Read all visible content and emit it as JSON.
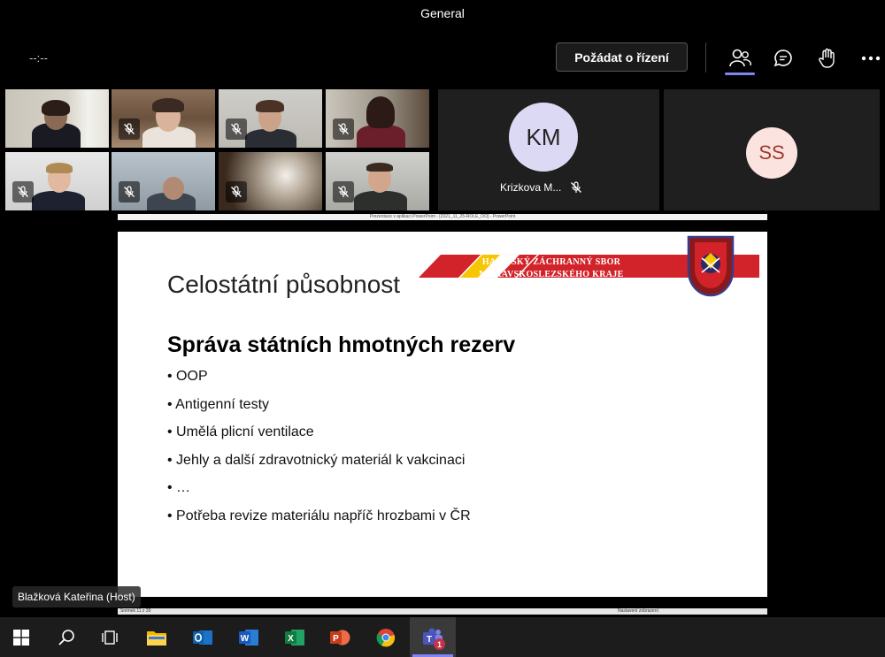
{
  "window": {
    "title": "General"
  },
  "toolbar": {
    "timer": "--:--",
    "request_control_label": "Požádat o řízení",
    "icons": [
      "people-icon",
      "chat-icon",
      "raise-hand-icon",
      "more-icon"
    ]
  },
  "participants": {
    "avatar_tiles": [
      {
        "initials": "KM",
        "name": "Krizkova M...",
        "avatar_color": "#dcd9f5",
        "text_color": "#252423"
      },
      {
        "initials": "SS",
        "name": "",
        "avatar_color": "#fbe3df",
        "text_color": "#a03a2c"
      }
    ]
  },
  "presentation": {
    "ppt_window_title": "Prezentace v aplikaci PowerPoint - [2021_11_25-ROLE_OO] - PowerPoint",
    "slide_title": "Celostátní působnost",
    "banner_line1": "HASIČSKÝ ZÁCHRANNÝ SBOR",
    "banner_line2": "MORAVSKOSLEZSKÉHO KRAJE",
    "heading": "Správa státních hmotných rezerv",
    "bullets": [
      "OOP",
      "Antigenní testy",
      " Umělá plicní ventilace",
      "Jehly a další zdravotnický materiál k vakcinaci",
      "…",
      "Potřeba revize materiálu napříč hrozbami v ČR"
    ],
    "status_left": "Snímek 11 z 39",
    "status_right": "Nastavení zobrazení"
  },
  "presenter": {
    "label": "Blažková Kateřina (Host)"
  },
  "taskbar": {
    "apps": [
      "windows-start-icon",
      "search-icon",
      "task-view-icon",
      "file-explorer-icon",
      "outlook-icon",
      "word-icon",
      "excel-icon",
      "powerpoint-icon",
      "chrome-icon",
      "teams-icon"
    ],
    "teams_badge": "1"
  },
  "colors": {
    "accent": "#7f85f5",
    "red": "#d2232a",
    "yellow": "#f6c600"
  }
}
